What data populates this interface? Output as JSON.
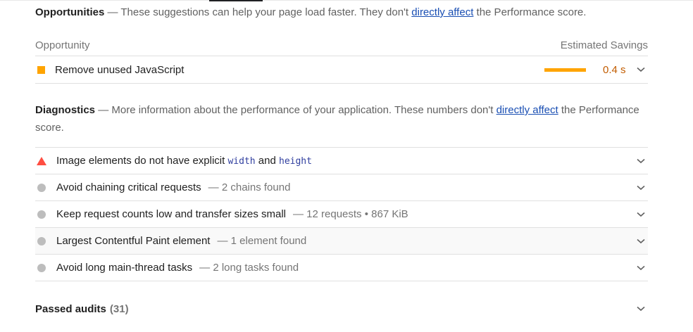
{
  "opportunities": {
    "title": "Opportunities",
    "desc_pre": " — These suggestions can help your page load faster. They don't ",
    "link": "directly affect",
    "desc_post": " the Performance score.",
    "col_opportunity": "Opportunity",
    "col_savings": "Estimated Savings",
    "items": [
      {
        "title": "Remove unused JavaScript",
        "savings": "0.4 s",
        "color": "#ffa400"
      }
    ]
  },
  "diagnostics": {
    "title": "Diagnostics",
    "desc_pre": " — More information about the performance of your application. These numbers don't ",
    "link": "directly affect",
    "desc_post": " the Performance score.",
    "items": [
      {
        "pre": "Image elements do not have explicit ",
        "code1": "width",
        "mid": " and ",
        "code2": "height",
        "severity": "fail"
      },
      {
        "title": "Avoid chaining critical requests",
        "detail": "— 2 chains found"
      },
      {
        "title": "Keep request counts low and transfer sizes small",
        "detail": "— 12 requests • 867 KiB"
      },
      {
        "title": "Largest Contentful Paint element",
        "detail": "— 1 element found"
      },
      {
        "title": "Avoid long main-thread tasks",
        "detail": "— 2 long tasks found"
      }
    ]
  },
  "passed": {
    "title": "Passed audits",
    "count": "(31)"
  },
  "colors": {
    "warn": "#ffa400",
    "fail": "#ff4e42",
    "neutral": "#bdbdbd",
    "link": "#1a4fb3"
  }
}
